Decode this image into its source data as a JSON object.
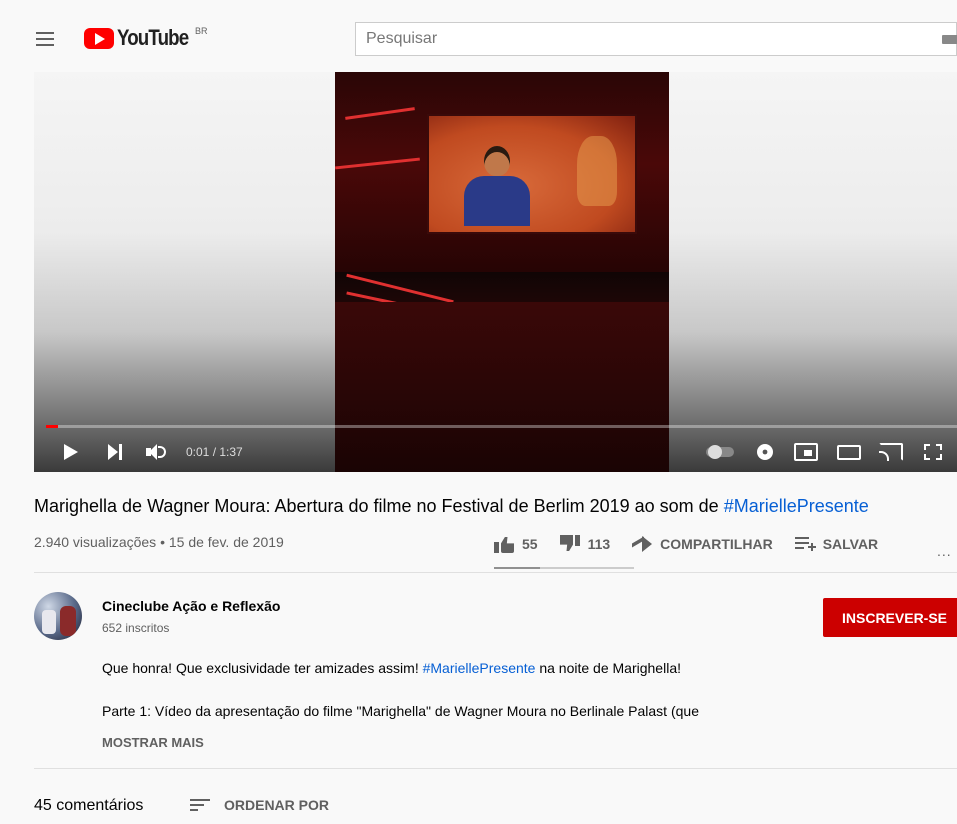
{
  "header": {
    "logo_text": "YouTube",
    "country_code": "BR",
    "search_placeholder": "Pesquisar"
  },
  "player": {
    "time_current": "0:01",
    "time_total": "1:37",
    "time_display": "0:01 / 1:37",
    "progress_percent": 1
  },
  "video": {
    "title_main": "Marighella de Wagner Moura: Abertura do filme no Festival de Berlim 2019 ao som de ",
    "title_hashtag": "#MariellePresente",
    "meta": "2.940 visualizações • 15 de fev. de 2019",
    "likes": "55",
    "dislikes": "113",
    "share_label": "COMPARTILHAR",
    "save_label": "SALVAR",
    "more_label": "...",
    "like_ratio": 0.33
  },
  "channel": {
    "name": "Cineclube Ação e Reflexão",
    "subscribers": "652 inscritos",
    "subscribe_label": "INSCREVER-SE"
  },
  "description": {
    "line1_before": "Que honra! Que exclusividade ter amizades assim! ",
    "line1_hashtag": "#MariellePresente",
    "line1_after": " na noite de Marighella!",
    "line2": "Parte 1: Vídeo da apresentação do filme \"Marighella\" de Wagner Moura no Berlinale Palast (que",
    "show_more_label": "MOSTRAR MAIS"
  },
  "comments": {
    "count_label": "45 comentários",
    "sort_label": "ORDENAR POR"
  },
  "colors": {
    "brand_red": "#ff0000",
    "subscribe_red": "#cc0000",
    "link_blue": "#065fd4"
  }
}
